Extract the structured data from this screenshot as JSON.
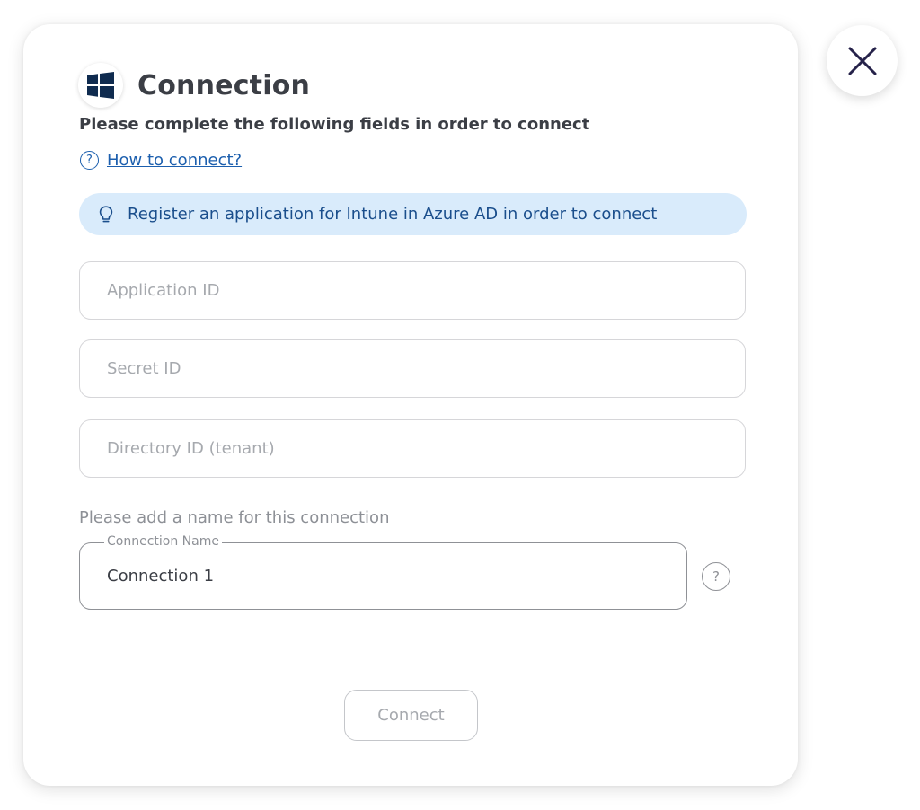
{
  "dialog": {
    "title": "Connection",
    "subtitle": "Please complete the following fields in order to connect",
    "help_link": "How to connect?",
    "help_glyph": "?",
    "info_banner": "Register an application for Intune in Azure AD in order to connect"
  },
  "fields": {
    "application_id": {
      "placeholder": "Application ID",
      "value": ""
    },
    "secret_id": {
      "placeholder": "Secret ID",
      "value": ""
    },
    "directory_id": {
      "placeholder": "Directory ID (tenant)",
      "value": ""
    }
  },
  "connection_name": {
    "prompt": "Please add a name for this connection",
    "label": "Connection Name",
    "value": "Connection 1",
    "help_glyph": "?"
  },
  "actions": {
    "connect_label": "Connect"
  },
  "icons": {
    "close": "close-icon",
    "logo": "windows-logo-icon",
    "help": "question-circle-icon",
    "tip": "lightbulb-icon"
  },
  "colors": {
    "accent": "#1c5fae",
    "banner_bg": "#d9ebfb",
    "banner_text": "#1a4e8c",
    "windows_logo": "#0f2b4f",
    "title_text": "#3b3e45"
  }
}
